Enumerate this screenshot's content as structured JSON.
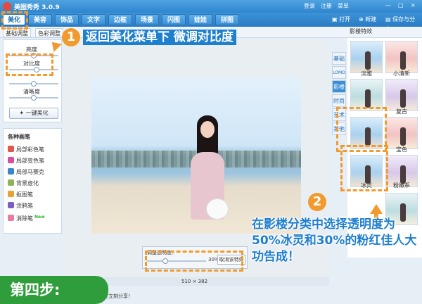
{
  "titlebar": {
    "title": "美图秀秀 3.0.9",
    "login": "登录",
    "register": "注册",
    "menu": "菜单",
    "minimize": "—",
    "maximize": "□",
    "close": "×"
  },
  "tabs": [
    {
      "label": "美化",
      "active": true
    },
    {
      "label": "美容",
      "active": false
    },
    {
      "label": "饰品",
      "active": false
    },
    {
      "label": "文字",
      "active": false
    },
    {
      "label": "边框",
      "active": false
    },
    {
      "label": "场景",
      "active": false
    },
    {
      "label": "闪图",
      "active": false
    },
    {
      "label": "娃娃",
      "active": false
    },
    {
      "label": "拼图",
      "active": false
    }
  ],
  "toolbar": {
    "open": "打开",
    "new": "新建",
    "save_share": "保存与分享"
  },
  "subtabs": {
    "basic_adjust": "基础调整",
    "color_adjust": "色彩调整"
  },
  "adjust": {
    "brightness": "亮度",
    "contrast": "对比度",
    "saturation": "清晰度",
    "one_key": "一键美化"
  },
  "brushes": {
    "heading": "各种画笔",
    "items": [
      "局部彩色笔",
      "局部变色笔",
      "局部马赛克",
      "背景虚化",
      "抠图笔",
      "涂鸦笔",
      "消除笔"
    ],
    "new_badge": "New"
  },
  "opacity": {
    "label": "调整透明度：",
    "value": "30%",
    "cancel": "取消该特效"
  },
  "status": {
    "size": "510 × 382",
    "share": "设定立刻分享！"
  },
  "filters": {
    "header": "影楼特效",
    "categories": [
      "基础",
      "LOMO",
      "影楼",
      "时尚",
      "艺术",
      "其他"
    ],
    "active_category": 2,
    "thumbs": [
      "淡雅",
      "小清新",
      "",
      "复古",
      "",
      "宝色",
      "冰灵",
      "粉嫩系",
      "",
      ""
    ]
  },
  "annotations": {
    "step1_num": "1",
    "step1_text": "返回美化菜单下 微调对比度",
    "step2_num": "2",
    "step2_text": "在影楼分类中选择透明度为50%冰灵和30%的粉红佳人大功告成！",
    "step_badge": "第四步:"
  },
  "colors": {
    "accent": "#2f86cf",
    "highlight": "#f29a2e",
    "badge": "#2f9d3c"
  }
}
